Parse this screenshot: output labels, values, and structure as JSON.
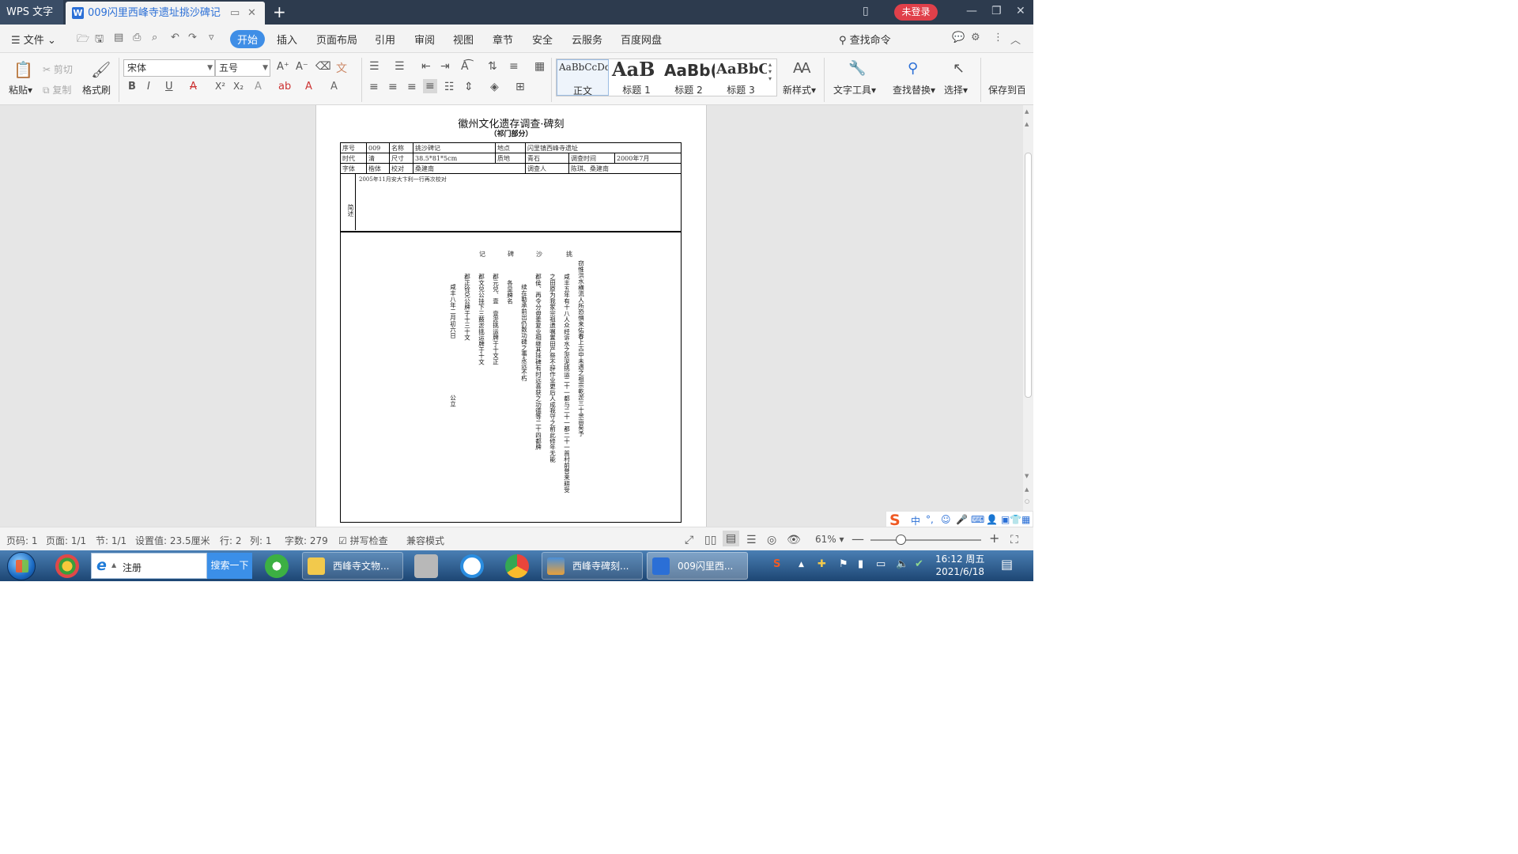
{
  "titlebar": {
    "app_name": "WPS 文字",
    "doc_tab": "009闪里西峰寺遗址挑沙碑记",
    "login": "未登录"
  },
  "menu": {
    "file": "文件",
    "tabs": [
      "开始",
      "插入",
      "页面布局",
      "引用",
      "审阅",
      "视图",
      "章节",
      "安全",
      "云服务",
      "百度网盘"
    ],
    "search_cmd": "查找命令"
  },
  "ribbon": {
    "paste": "粘贴",
    "cut": "剪切",
    "copy": "复制",
    "format_painter": "格式刷",
    "font_name": "宋体",
    "font_size": "五号",
    "styles": [
      {
        "sample": "AaBbCcDd",
        "label": "正文"
      },
      {
        "sample": "AaB",
        "label": "标题 1"
      },
      {
        "sample": "AaBb(",
        "label": "标题 2"
      },
      {
        "sample": "AaBbC",
        "label": "标题 3"
      }
    ],
    "new_style": "新样式",
    "text_tools": "文字工具",
    "find_replace": "查找替换",
    "select": "选择",
    "save_to": "保存到百"
  },
  "document": {
    "title": "徽州文化遗存调查·碑刻",
    "subtitle": "（祁门部分）",
    "rows": [
      [
        "序号",
        "009",
        "名称",
        "挑沙碑记",
        "地点",
        "闪里镇西峰寺遗址"
      ],
      [
        "时代",
        "清",
        "尺寸",
        "38.5*81*5cm",
        "质地",
        "青石",
        "调查时间",
        "2000年7月"
      ],
      [
        "字体",
        "楷体",
        "校对",
        "桑建南",
        "调查人",
        "陈琪、桑建南"
      ]
    ],
    "desc_label": "简述",
    "desc_text": "2005年11月安大卞利一行再次校对",
    "inscription_title": [
      "挑",
      "沙",
      "碑",
      "记"
    ],
    "inscription_cols": [
      "窃惟洪水横流人所恐惧来佑春上古中未遇之祖宗乾淤三十余亩矣予",
      "咸丰五年有十八人众经诉水之淤泥挑运二十一都与二十一都二十一首村前曾来耕受",
      "之田原为我家宗祖遗嘱置田产祭不辞作业更后人成我守之前此修年无能",
      "郡侯、再令分毋辈复业相继其挂碑有时远喜获之功德等二十四都牌",
      "续在勒承前出仍数功碑之事永远不朽",
      "各显牌名",
      "郡元兑、壹　壹淤挑运牌于十文正",
      "郡文兑公挂下三鼓淤挑运牌于十文",
      "郡正铨兑公牌于十三十文",
      "咸丰八年二月初六日"
    ],
    "inscription_tail": "公立"
  },
  "status": {
    "page": "页码: 1",
    "pages": "页面: 1/1",
    "section": "节: 1/1",
    "setting": "设置值: 23.5厘米",
    "line": "行: 2",
    "col": "列: 1",
    "words": "字数: 279",
    "spell": "拼写检查",
    "compat": "兼容模式",
    "zoom": "61%"
  },
  "ime": {
    "mode": "中"
  },
  "taskbar": {
    "search_text": "注册",
    "search_btn": "搜索一下",
    "buttons": [
      "西峰寺文物...",
      "西峰寺碑刻...",
      "009闪里西..."
    ],
    "time": "16:12 周五",
    "date": "2021/6/18"
  },
  "colors": {
    "title_bg": "#2d3b4e",
    "accent": "#3f8ee6",
    "login_red": "#e0404a",
    "taskbar": "#2b5b8c"
  }
}
